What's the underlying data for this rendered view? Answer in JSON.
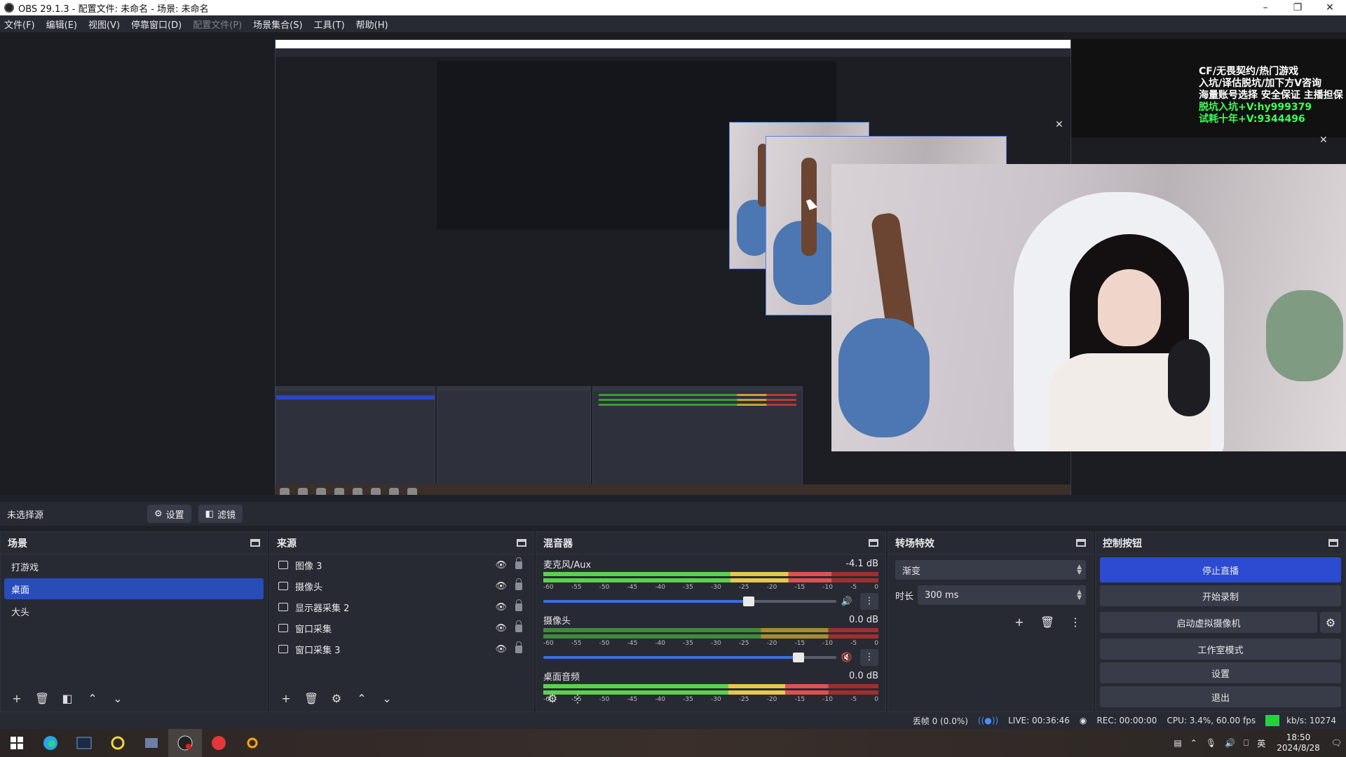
{
  "window": {
    "title": "OBS 29.1.3 - 配置文件: 未命名 - 场景: 未命名"
  },
  "menu": {
    "file": "文件(F)",
    "edit": "编辑(E)",
    "view": "视图(V)",
    "docks": "停靠窗口(D)",
    "profile": "配置文件(P)",
    "scene_collection": "场景集合(S)",
    "tools": "工具(T)",
    "help": "帮助(H)"
  },
  "overlay": {
    "line1": "CF/无畏契约/热门游戏",
    "line2": "入坑/译估脱坑/加下方V咨询",
    "line3": "海量账号选择 安全保证 主播担保",
    "line4": "脱坑入坑+V:hy999379",
    "line5": "试耗十年+V:9344496"
  },
  "source_bar": {
    "label": "未选择源",
    "settings": "设置",
    "filters": "滤镜"
  },
  "scenes": {
    "title": "场景",
    "items": [
      "打游戏",
      "桌面",
      "大头"
    ],
    "selected": 1
  },
  "sources": {
    "title": "来源",
    "items": [
      {
        "name": "图像 3",
        "icon": "image-icon"
      },
      {
        "name": "摄像头",
        "icon": "camera-icon"
      },
      {
        "name": "显示器采集 2",
        "icon": "monitor-icon"
      },
      {
        "name": "窗口采集",
        "icon": "window-icon"
      },
      {
        "name": "窗口采集 3",
        "icon": "window-icon"
      }
    ]
  },
  "mixer": {
    "title": "混音器",
    "ticks": [
      "-60",
      "-55",
      "-50",
      "-45",
      "-40",
      "-35",
      "-30",
      "-25",
      "-20",
      "-15",
      "-10",
      "-5",
      "0"
    ],
    "channels": [
      {
        "name": "麦克风/Aux",
        "db": "-4.1 dB",
        "volume": 0.7,
        "level": 0.86,
        "muted": false
      },
      {
        "name": "摄像头",
        "db": "0.0 dB",
        "volume": 0.87,
        "level": 0.0,
        "muted": true
      },
      {
        "name": "桌面音频",
        "db": "0.0 dB",
        "volume": 0.9,
        "level": 0.85,
        "muted": false
      }
    ]
  },
  "transitions": {
    "title": "转场特效",
    "selected": "渐变",
    "duration_label": "时长",
    "duration": "300 ms"
  },
  "controls": {
    "title": "控制按钮",
    "stop_stream": "停止直播",
    "start_record": "开始录制",
    "virtual_cam": "启动虚拟摄像机",
    "studio_mode": "工作室模式",
    "settings": "设置",
    "exit": "退出"
  },
  "status": {
    "dropped": "丢帧 0 (0.0%)",
    "live": "LIVE: 00:36:46",
    "rec": "REC: 00:00:00",
    "cpu": "CPU: 3.4%, 60.00 fps",
    "kbps": "kb/s: 10274"
  },
  "tray": {
    "ime": "英",
    "time": "18:50",
    "date": "2024/8/28"
  },
  "colors": {
    "accent": "#284cb8",
    "primary_button": "#2c4bd0",
    "status_ok": "#22d43a",
    "overlay_green": "#3cff57"
  }
}
